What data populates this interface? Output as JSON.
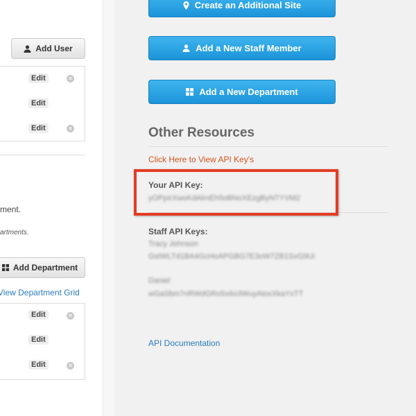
{
  "users_section": {
    "add_user_label": "Add User",
    "rows": [
      {
        "edit_label": "Edit",
        "has_delete": true
      },
      {
        "edit_label": "Edit",
        "has_delete": false
      },
      {
        "edit_label": "Edit",
        "has_delete": true
      }
    ]
  },
  "departments_section": {
    "text_fragment": "ment.",
    "italic_fragment": "artments.",
    "add_department_label": "Add Department",
    "view_grid_link": "View Department Grid",
    "rows": [
      {
        "edit_label": "Edit",
        "has_delete": true
      },
      {
        "edit_label": "Edit",
        "has_delete": false
      },
      {
        "edit_label": "Edit",
        "has_delete": true
      }
    ]
  },
  "actions": {
    "create_site_label": "Create an Additional Site",
    "add_staff_label": "Add a New Staff Member",
    "add_department_label": "Add a New Department"
  },
  "other_resources": {
    "title": "Other Resources",
    "view_api_keys_link": "Click Here to View API Key's",
    "your_api_key_label": "Your API Key:",
    "your_api_key_value": "yOPpIrXwoKdAlmEh5oBNoXEzgByNTYVM2",
    "staff_api_keys_label": "Staff API Keys:",
    "staff_keys": [
      {
        "name": "Tracy Johnson",
        "key": "GstWLTd1BA4GcHoAPGBG7E3oW7ZB1SvG9Ui"
      },
      {
        "name": "Daniel",
        "key": "wGaSbm7nRWdGRo5x6o3WuyAtoxXkaYxTT"
      }
    ],
    "api_documentation_link": "API Documentation"
  },
  "colors": {
    "primary_blue": "#1b94d9",
    "link_orange": "#d4531b",
    "link_blue": "#2a7bbf",
    "highlight_red": "#e53a24"
  }
}
